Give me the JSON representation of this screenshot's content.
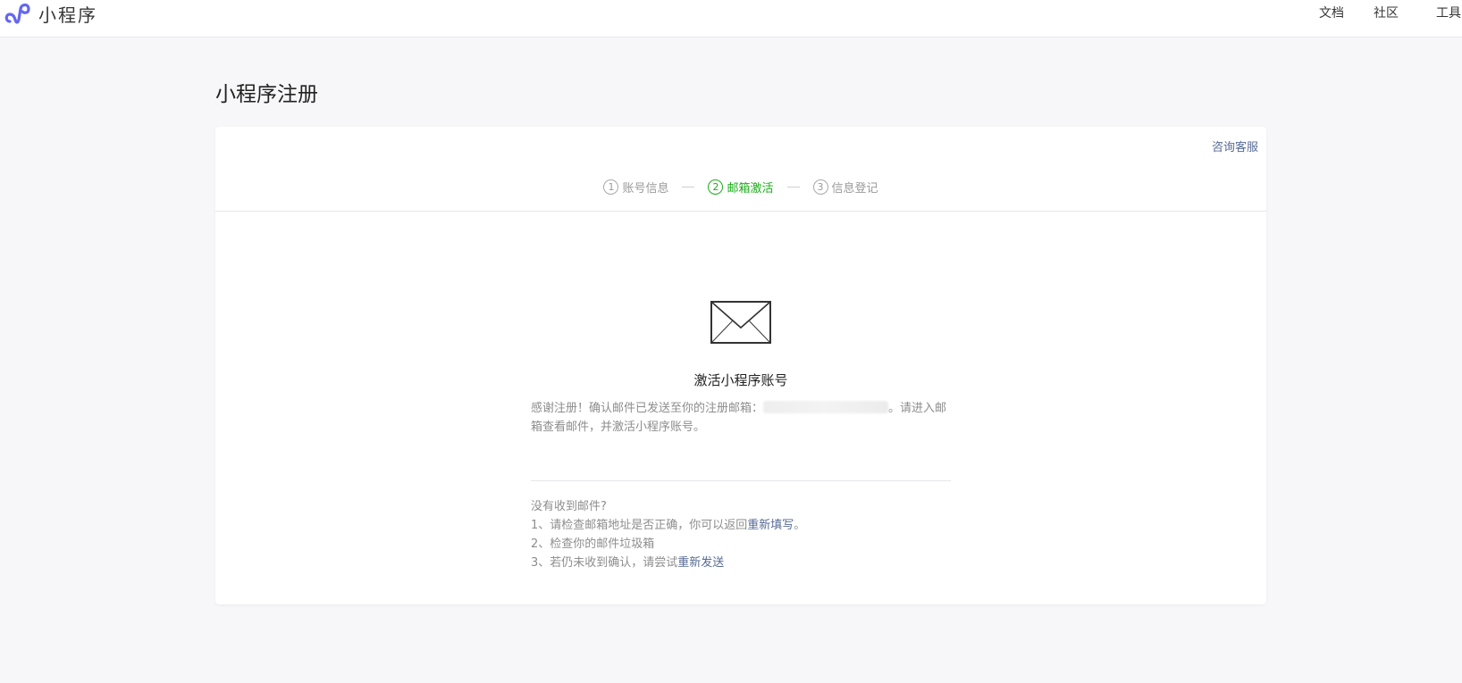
{
  "header": {
    "brand_name": "小程序",
    "nav": {
      "docs": "文档",
      "community": "社区",
      "tools": "工具"
    }
  },
  "page": {
    "title": "小程序注册"
  },
  "card": {
    "consult_link": "咨询客服",
    "steps": [
      {
        "num": "1",
        "label": "账号信息",
        "state": "done"
      },
      {
        "num": "2",
        "label": "邮箱激活",
        "state": "active"
      },
      {
        "num": "3",
        "label": "信息登记",
        "state": "todo"
      }
    ],
    "icon": "envelope-icon",
    "activate_title": "激活小程序账号",
    "intro_before": "感谢注册！确认邮件已发送至你的注册邮箱：",
    "intro_after": "。请进入邮箱查看邮件，并激活小程序账号。",
    "help": {
      "question": "没有收到邮件?",
      "item1_prefix": "1、请检查邮箱地址是否正确，你可以返回",
      "item1_link": "重新填写",
      "item1_suffix": "。",
      "item2": "2、检查你的邮件垃圾箱",
      "item3_prefix": "3、若仍未收到确认，请尝试",
      "item3_link": "重新发送"
    }
  },
  "colors": {
    "brand_purple": "#6467f0",
    "active_green": "#1aad19",
    "link_blue": "#576b95"
  }
}
